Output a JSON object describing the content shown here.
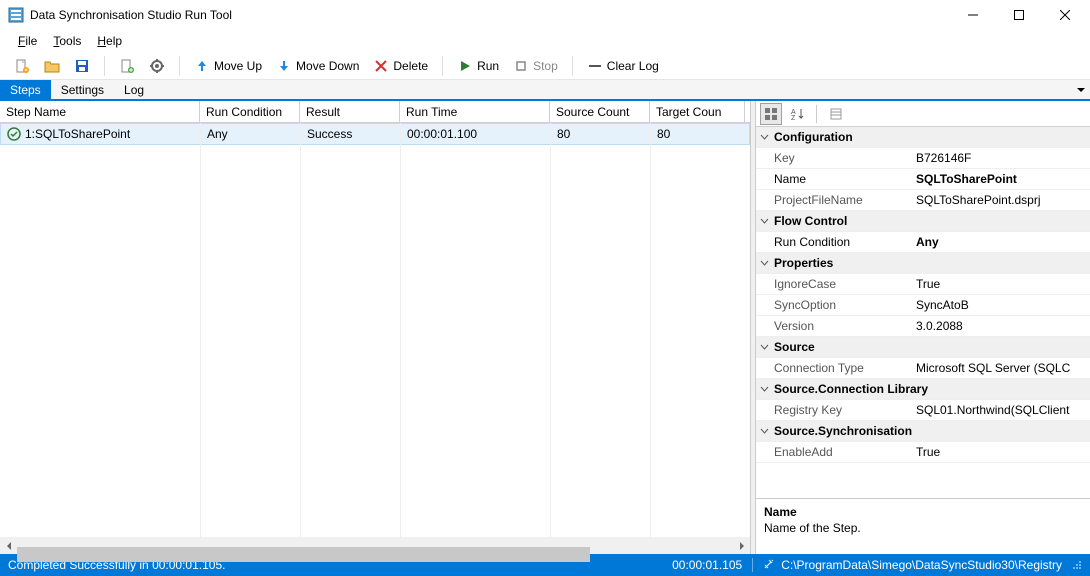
{
  "window": {
    "title": "Data Synchronisation Studio Run Tool"
  },
  "menu": {
    "file": "File",
    "tools": "Tools",
    "help": "Help"
  },
  "toolbar": {
    "move_up": "Move Up",
    "move_down": "Move Down",
    "delete": "Delete",
    "run": "Run",
    "stop": "Stop",
    "clear_log": "Clear Log"
  },
  "tabs": {
    "steps": "Steps",
    "settings": "Settings",
    "log": "Log"
  },
  "grid": {
    "columns": {
      "step_name": "Step Name",
      "run_condition": "Run Condition",
      "result": "Result",
      "run_time": "Run Time",
      "source_count": "Source Count",
      "target_count": "Target Coun"
    },
    "rows": [
      {
        "step_name": "1:SQLToSharePoint",
        "run_condition": "Any",
        "result": "Success",
        "run_time": "00:00:01.100",
        "source_count": "80",
        "target_count": "80"
      }
    ]
  },
  "props": {
    "categories": [
      {
        "label": "Configuration",
        "items": [
          {
            "label": "Key",
            "value": "B726146F",
            "bold": false
          },
          {
            "label": "Name",
            "value": "SQLToSharePoint",
            "bold": true
          },
          {
            "label": "ProjectFileName",
            "value": "SQLToSharePoint.dsprj",
            "bold": false
          }
        ]
      },
      {
        "label": "Flow Control",
        "items": [
          {
            "label": "Run Condition",
            "value": "Any",
            "bold": true
          }
        ]
      },
      {
        "label": "Properties",
        "items": [
          {
            "label": "IgnoreCase",
            "value": "True",
            "bold": false
          },
          {
            "label": "SyncOption",
            "value": "SyncAtoB",
            "bold": false
          },
          {
            "label": "Version",
            "value": "3.0.2088",
            "bold": false
          }
        ]
      },
      {
        "label": "Source",
        "items": [
          {
            "label": "Connection Type",
            "value": "Microsoft SQL Server (SQLC",
            "bold": false
          }
        ]
      },
      {
        "label": "Source.Connection Library",
        "items": [
          {
            "label": "Registry Key",
            "value": "SQL01.Northwind(SQLClient",
            "bold": false
          }
        ]
      },
      {
        "label": "Source.Synchronisation",
        "items": [
          {
            "label": "EnableAdd",
            "value": "True",
            "bold": false
          }
        ]
      }
    ],
    "desc": {
      "title": "Name",
      "text": "Name of the Step."
    }
  },
  "status": {
    "message": "Completed Successfully in 00:00:01.105.",
    "time": "00:00:01.105",
    "path": "C:\\ProgramData\\Simego\\DataSyncStudio30\\Registry"
  }
}
